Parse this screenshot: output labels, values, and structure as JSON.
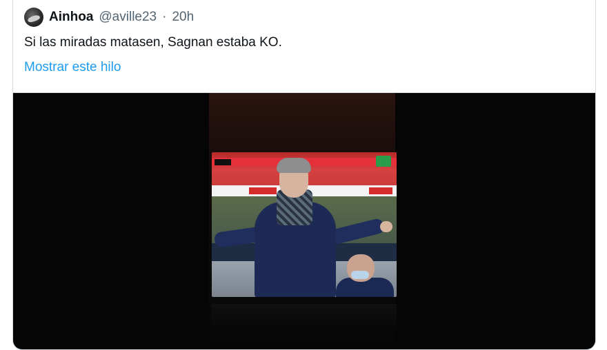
{
  "tweet": {
    "author_name": "Ainhoa",
    "author_handle": "@aville23",
    "separator": "·",
    "time": "20h",
    "text": "Si las miradas matasen, Sagnan estaba KO.",
    "show_thread_label": "Mostrar este hilo"
  },
  "colors": {
    "text": "#0f1419",
    "secondary": "#536471",
    "link": "#1d9bf0",
    "border": "#d6dbe0"
  },
  "icons": {
    "avatar": "avatar-image"
  }
}
